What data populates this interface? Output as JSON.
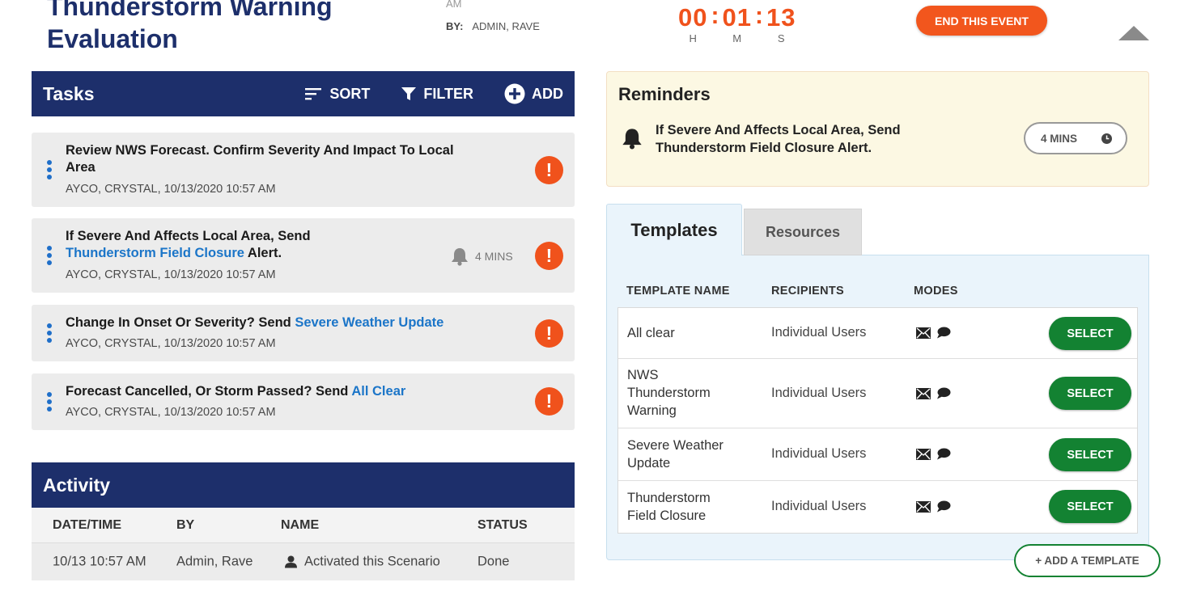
{
  "header": {
    "title_line1": "Thunderstorm Warning",
    "title_line2": "Evaluation",
    "meta_top": "AM",
    "by_label": "BY:",
    "by_value": "ADMIN, RAVE"
  },
  "timer": {
    "hours": "00",
    "minutes": "01",
    "seconds": "13",
    "hours_label": "H",
    "minutes_label": "M",
    "seconds_label": "S"
  },
  "end_event_label": "END THIS EVENT",
  "tasks": {
    "title": "Tasks",
    "sort_label": "SORT",
    "filter_label": "FILTER",
    "add_label": "ADD",
    "items": [
      {
        "text": "Review NWS Forecast. Confirm Severity And Impact To Local",
        "text2": "Area",
        "sub": "AYCO, CRYSTAL, 10/13/2020 10:57 AM"
      },
      {
        "text": "If Severe And Affects Local Area, Send",
        "link": "Thunderstorm Field Closure",
        "text_after": " Alert.",
        "reminder": "4 MINS",
        "sub": "AYCO, CRYSTAL, 10/13/2020 10:57 AM"
      },
      {
        "text": "Change In Onset Or Severity? Send ",
        "link": "Severe Weather Update",
        "sub": "AYCO, CRYSTAL, 10/13/2020 10:57 AM"
      },
      {
        "text": "Forecast Cancelled, Or Storm Passed? Send ",
        "link": "All Clear",
        "sub": "AYCO, CRYSTAL, 10/13/2020 10:57 AM"
      }
    ]
  },
  "activity": {
    "title": "Activity",
    "columns": [
      "DATE/TIME",
      "BY",
      "NAME",
      "STATUS"
    ],
    "rows": [
      {
        "datetime": "10/13 10:57 AM",
        "by": "Admin, Rave",
        "name": "Activated this Scenario",
        "status": "Done"
      }
    ]
  },
  "reminders": {
    "title": "Reminders",
    "text_line1": "If Severe And Affects Local Area, Send",
    "text_line2": "Thunderstorm Field Closure Alert.",
    "time": "4 MINS"
  },
  "templates": {
    "tab_active": "Templates",
    "tab_inactive": "Resources",
    "columns": [
      "TEMPLATE NAME",
      "RECIPIENTS",
      "MODES"
    ],
    "select_label": "SELECT",
    "add_label": "+ ADD A TEMPLATE",
    "rows": [
      {
        "name": "All clear",
        "recipients": "Individual Users"
      },
      {
        "name": "NWS Thunderstorm Warning",
        "recipients": "Individual Users"
      },
      {
        "name": "Severe Weather Update",
        "recipients": "Individual Users"
      },
      {
        "name": "Thunderstorm Field Closure",
        "recipients": "Individual Users"
      }
    ]
  },
  "colors": {
    "navy": "#1d2f6b",
    "orange": "#f0521c",
    "green": "#138232",
    "link_blue": "#1b75c8"
  }
}
